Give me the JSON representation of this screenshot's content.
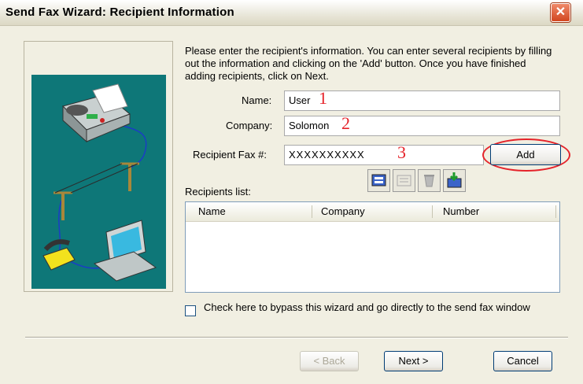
{
  "window": {
    "title": "Send Fax Wizard: Recipient Information",
    "close_label": "✕"
  },
  "instructions": "Please enter the recipient's information. You can enter several recipients by filling out the information and clicking  on the 'Add' button. Once you have finished adding recipients, click on Next.",
  "form": {
    "name_label": "Name:",
    "name_value": "User",
    "company_label": "Company:",
    "company_value": "Solomon",
    "fax_label": "Recipient Fax #:",
    "fax_value": "XXXXXXXXXX",
    "add_label": "Add"
  },
  "annotations": {
    "mark1": "1",
    "mark2": "2",
    "mark3": "3",
    "color": "#e5232a"
  },
  "toolbar_icons": [
    "address-book-icon",
    "edit-recipient-icon",
    "delete-recipient-icon",
    "import-icon"
  ],
  "recipients": {
    "label": "Recipients list:",
    "columns": [
      "Name",
      "Company",
      "Number"
    ],
    "rows": []
  },
  "bypass": {
    "checked": false,
    "label": "Check here to bypass this wizard and go directly to the send fax window"
  },
  "buttons": {
    "back": "< Back",
    "next": "Next >",
    "cancel": "Cancel"
  },
  "colors": {
    "illustration_bg": "#0e7778",
    "dialog_bg": "#f1efe2",
    "accent": "#003c74"
  }
}
